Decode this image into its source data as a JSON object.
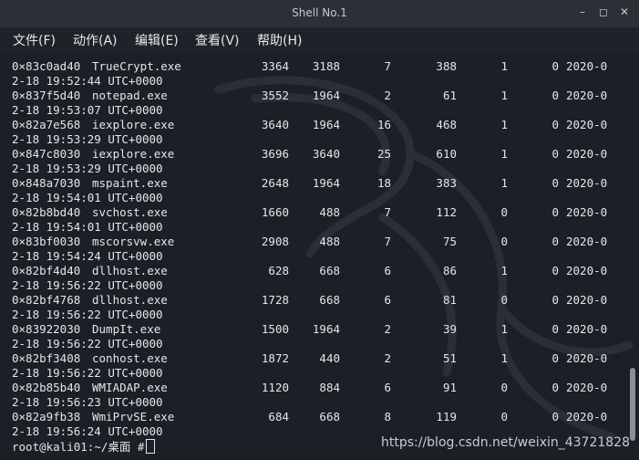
{
  "window": {
    "title": "Shell No.1"
  },
  "window_controls": {
    "minimize": "–",
    "maximize": "◻",
    "close": "✕"
  },
  "menu": [
    "文件(F)",
    "动作(A)",
    "编辑(E)",
    "查看(V)",
    "帮助(H)"
  ],
  "processes": [
    {
      "addr": "0×83c0ad40",
      "name": "TrueCrypt.exe",
      "pid": "3364",
      "ppid": "3188",
      "thds": "7",
      "hnds": "388",
      "sess": "1",
      "wow64": "0",
      "date_a": "2020-0",
      "date_b": "2-18 19:52:44 UTC+0000"
    },
    {
      "addr": "0×837f5d40",
      "name": "notepad.exe",
      "pid": "3552",
      "ppid": "1964",
      "thds": "2",
      "hnds": "61",
      "sess": "1",
      "wow64": "0",
      "date_a": "2020-0",
      "date_b": "2-18 19:53:07 UTC+0000"
    },
    {
      "addr": "0×82a7e568",
      "name": "iexplore.exe",
      "pid": "3640",
      "ppid": "1964",
      "thds": "16",
      "hnds": "468",
      "sess": "1",
      "wow64": "0",
      "date_a": "2020-0",
      "date_b": "2-18 19:53:29 UTC+0000"
    },
    {
      "addr": "0×847c8030",
      "name": "iexplore.exe",
      "pid": "3696",
      "ppid": "3640",
      "thds": "25",
      "hnds": "610",
      "sess": "1",
      "wow64": "0",
      "date_a": "2020-0",
      "date_b": "2-18 19:53:29 UTC+0000"
    },
    {
      "addr": "0×848a7030",
      "name": "mspaint.exe",
      "pid": "2648",
      "ppid": "1964",
      "thds": "18",
      "hnds": "383",
      "sess": "1",
      "wow64": "0",
      "date_a": "2020-0",
      "date_b": "2-18 19:54:01 UTC+0000"
    },
    {
      "addr": "0×82b8bd40",
      "name": "svchost.exe",
      "pid": "1660",
      "ppid": "488",
      "thds": "7",
      "hnds": "112",
      "sess": "0",
      "wow64": "0",
      "date_a": "2020-0",
      "date_b": "2-18 19:54:01 UTC+0000"
    },
    {
      "addr": "0×83bf0030",
      "name": "mscorsvw.exe",
      "pid": "2908",
      "ppid": "488",
      "thds": "7",
      "hnds": "75",
      "sess": "0",
      "wow64": "0",
      "date_a": "2020-0",
      "date_b": "2-18 19:54:24 UTC+0000"
    },
    {
      "addr": "0×82bf4d40",
      "name": "dllhost.exe",
      "pid": "628",
      "ppid": "668",
      "thds": "6",
      "hnds": "86",
      "sess": "1",
      "wow64": "0",
      "date_a": "2020-0",
      "date_b": "2-18 19:56:22 UTC+0000"
    },
    {
      "addr": "0×82bf4768",
      "name": "dllhost.exe",
      "pid": "1728",
      "ppid": "668",
      "thds": "6",
      "hnds": "81",
      "sess": "0",
      "wow64": "0",
      "date_a": "2020-0",
      "date_b": "2-18 19:56:22 UTC+0000"
    },
    {
      "addr": "0×83922030",
      "name": "DumpIt.exe",
      "pid": "1500",
      "ppid": "1964",
      "thds": "2",
      "hnds": "39",
      "sess": "1",
      "wow64": "0",
      "date_a": "2020-0",
      "date_b": "2-18 19:56:22 UTC+0000"
    },
    {
      "addr": "0×82bf3408",
      "name": "conhost.exe",
      "pid": "1872",
      "ppid": "440",
      "thds": "2",
      "hnds": "51",
      "sess": "1",
      "wow64": "0",
      "date_a": "2020-0",
      "date_b": "2-18 19:56:22 UTC+0000"
    },
    {
      "addr": "0×82b85b40",
      "name": "WMIADAP.exe",
      "pid": "1120",
      "ppid": "884",
      "thds": "6",
      "hnds": "91",
      "sess": "0",
      "wow64": "0",
      "date_a": "2020-0",
      "date_b": "2-18 19:56:23 UTC+0000"
    },
    {
      "addr": "0×82a9fb38",
      "name": "WmiPrvSE.exe",
      "pid": "684",
      "ppid": "668",
      "thds": "8",
      "hnds": "119",
      "sess": "0",
      "wow64": "0",
      "date_a": "2020-0",
      "date_b": "2-18 19:56:24 UTC+0000"
    }
  ],
  "prompt": "root@kali01:~/桌面 #",
  "watermark_url": "https://blog.csdn.net/weixin_43721828",
  "colors": {
    "background": "#1c2026",
    "text": "#e3e6ea",
    "titlebar": "#2b2f36"
  }
}
